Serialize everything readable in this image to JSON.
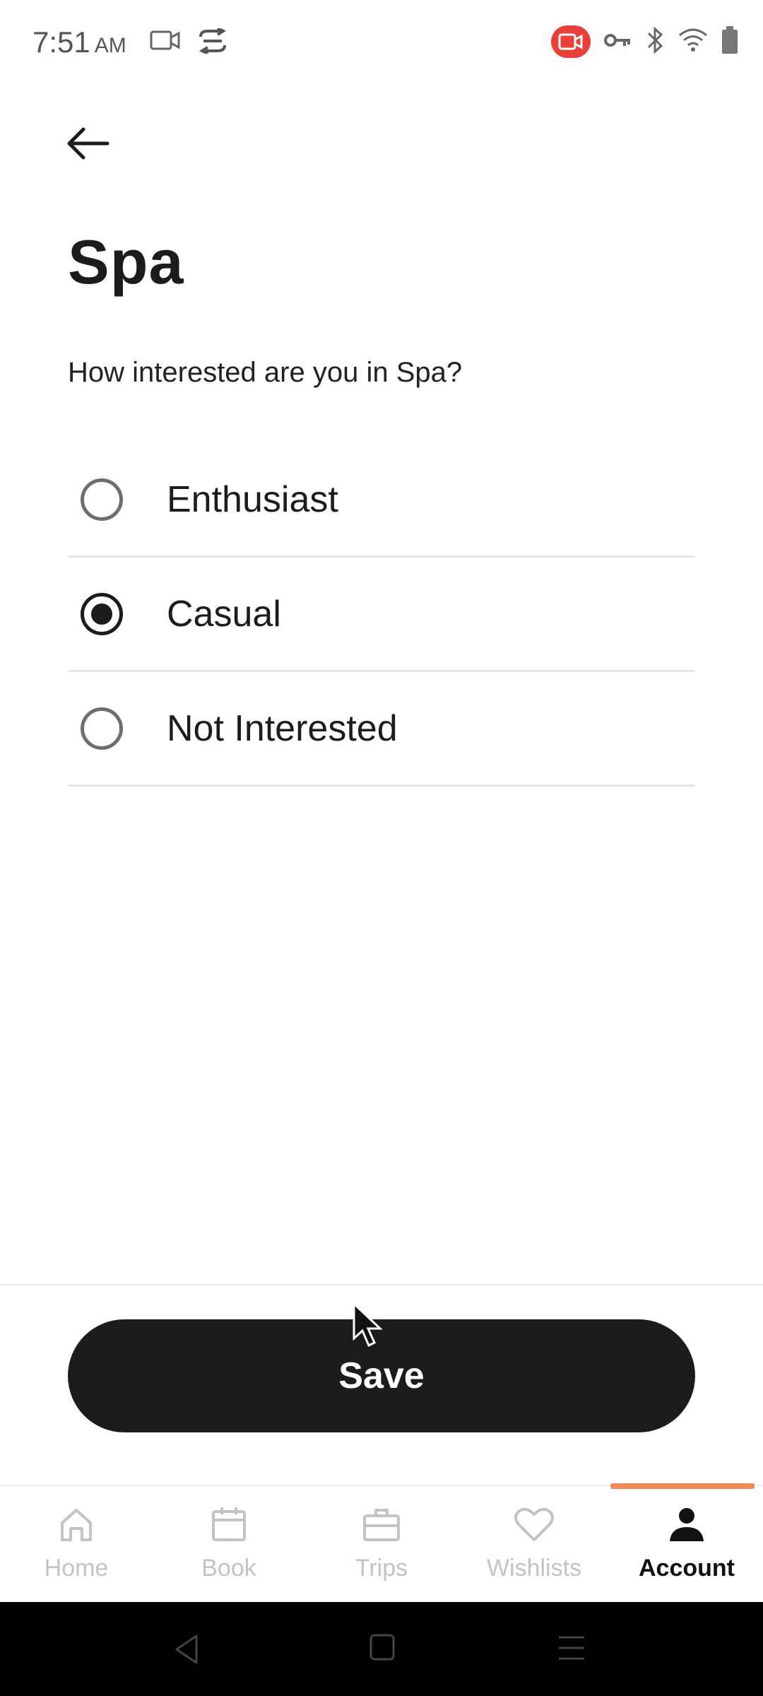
{
  "status_bar": {
    "time": "7:51",
    "ampm": "AM"
  },
  "header": {
    "back_icon": "arrow-left-icon"
  },
  "page": {
    "title": "Spa",
    "question": "How interested are you in Spa?"
  },
  "options": [
    {
      "label": "Enthusiast",
      "selected": false
    },
    {
      "label": "Casual",
      "selected": true
    },
    {
      "label": "Not Interested",
      "selected": false
    }
  ],
  "actions": {
    "save_label": "Save"
  },
  "bottom_nav": {
    "items": [
      {
        "label": "Home",
        "icon": "home-icon"
      },
      {
        "label": "Book",
        "icon": "calendar-icon"
      },
      {
        "label": "Trips",
        "icon": "briefcase-icon"
      },
      {
        "label": "Wishlists",
        "icon": "heart-icon"
      },
      {
        "label": "Account",
        "icon": "person-icon",
        "active": true
      }
    ]
  },
  "colors": {
    "primary": "#1c1c1c",
    "accent": "#f08a58",
    "recording": "#e8403b",
    "inactive": "#c3c3c3"
  }
}
